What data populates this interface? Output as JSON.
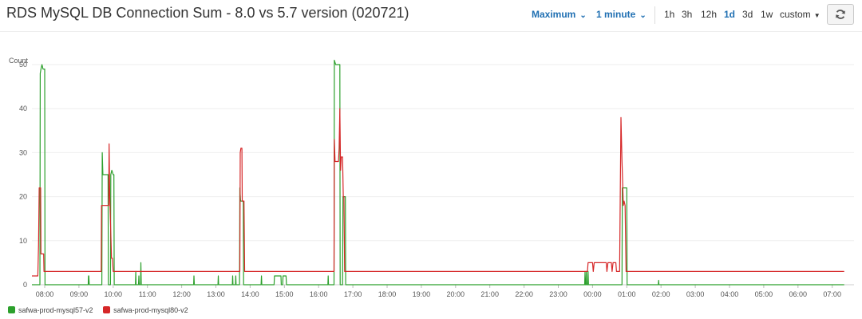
{
  "header": {
    "title": "RDS MySQL DB Connection Sum - 8.0 vs 5.7 version (020721)"
  },
  "toolbar": {
    "statistic": "Maximum",
    "period": "1 minute",
    "ranges": [
      "1h",
      "3h",
      "12h",
      "1d",
      "3d",
      "1w"
    ],
    "active_range": "1d",
    "custom_label": "custom",
    "refresh_icon": "refresh-icon"
  },
  "colors": {
    "series_57": "#2ca02c",
    "series_80": "#d62728",
    "accent": "#1f6fb2"
  },
  "chart_data": {
    "type": "line",
    "ylabel": "Count",
    "ylim": [
      0,
      52
    ],
    "yticks": [
      0,
      10,
      20,
      30,
      40,
      50
    ],
    "grid": true,
    "legend_position": "bottom-left",
    "x_ticks": [
      "08:00",
      "09:00",
      "10:00",
      "11:00",
      "12:00",
      "13:00",
      "14:00",
      "15:00",
      "16:00",
      "17:00",
      "18:00",
      "19:00",
      "20:00",
      "21:00",
      "22:00",
      "23:00",
      "00:00",
      "01:00",
      "02:00",
      "03:00",
      "04:00",
      "05:00",
      "06:00",
      "07:00"
    ],
    "x_range_hours": [
      7.55,
      31.35
    ],
    "series": [
      {
        "name": "safwa-prod-mysql57-v2",
        "color": "#2ca02c",
        "points": [
          [
            7.55,
            0
          ],
          [
            7.86,
            0
          ],
          [
            7.87,
            48
          ],
          [
            7.89,
            49
          ],
          [
            7.92,
            50
          ],
          [
            7.95,
            49
          ],
          [
            8.0,
            49
          ],
          [
            8.01,
            0
          ],
          [
            9.27,
            0
          ],
          [
            9.28,
            2
          ],
          [
            9.29,
            2
          ],
          [
            9.3,
            0
          ],
          [
            9.67,
            0
          ],
          [
            9.68,
            30
          ],
          [
            9.7,
            25
          ],
          [
            9.85,
            25
          ],
          [
            9.86,
            0
          ],
          [
            9.92,
            0
          ],
          [
            9.93,
            25
          ],
          [
            9.96,
            26
          ],
          [
            10.0,
            25
          ],
          [
            10.02,
            25
          ],
          [
            10.03,
            0
          ],
          [
            10.65,
            0
          ],
          [
            10.66,
            3
          ],
          [
            10.67,
            0
          ],
          [
            10.74,
            0
          ],
          [
            10.75,
            2
          ],
          [
            10.76,
            0
          ],
          [
            10.8,
            0
          ],
          [
            10.81,
            5
          ],
          [
            10.82,
            0
          ],
          [
            12.35,
            0
          ],
          [
            12.36,
            2
          ],
          [
            12.37,
            0
          ],
          [
            13.06,
            0
          ],
          [
            13.07,
            2
          ],
          [
            13.08,
            0
          ],
          [
            13.48,
            0
          ],
          [
            13.49,
            2
          ],
          [
            13.5,
            0
          ],
          [
            13.57,
            0
          ],
          [
            13.58,
            2
          ],
          [
            13.59,
            0
          ],
          [
            13.69,
            0
          ],
          [
            13.7,
            22
          ],
          [
            13.72,
            19
          ],
          [
            13.8,
            19
          ],
          [
            13.81,
            0
          ],
          [
            14.32,
            0
          ],
          [
            14.33,
            2
          ],
          [
            14.34,
            0
          ],
          [
            14.7,
            0
          ],
          [
            14.71,
            2
          ],
          [
            14.9,
            2
          ],
          [
            14.91,
            0
          ],
          [
            14.95,
            0
          ],
          [
            14.96,
            2
          ],
          [
            15.05,
            2
          ],
          [
            15.06,
            0
          ],
          [
            16.27,
            0
          ],
          [
            16.28,
            2
          ],
          [
            16.29,
            0
          ],
          [
            16.45,
            0
          ],
          [
            16.46,
            51
          ],
          [
            16.5,
            50
          ],
          [
            16.62,
            50
          ],
          [
            16.63,
            0
          ],
          [
            16.7,
            0
          ],
          [
            16.71,
            20
          ],
          [
            16.78,
            20
          ],
          [
            16.79,
            0
          ],
          [
            23.77,
            0
          ],
          [
            23.78,
            3
          ],
          [
            23.79,
            0
          ],
          [
            23.81,
            0
          ],
          [
            23.82,
            3
          ],
          [
            23.83,
            0
          ],
          [
            23.86,
            0
          ],
          [
            23.87,
            3
          ],
          [
            23.88,
            0
          ],
          [
            24.86,
            0
          ],
          [
            24.87,
            22
          ],
          [
            24.9,
            22
          ],
          [
            25.0,
            22
          ],
          [
            25.01,
            0
          ],
          [
            25.92,
            0
          ],
          [
            25.93,
            1
          ],
          [
            25.94,
            0
          ],
          [
            31.35,
            0
          ]
        ]
      },
      {
        "name": "safwa-prod-mysql80-v2",
        "color": "#d62728",
        "points": [
          [
            7.55,
            2
          ],
          [
            7.8,
            2
          ],
          [
            7.82,
            9
          ],
          [
            7.84,
            22
          ],
          [
            7.88,
            22
          ],
          [
            7.89,
            7
          ],
          [
            7.97,
            7
          ],
          [
            7.98,
            3
          ],
          [
            9.65,
            3
          ],
          [
            9.66,
            18
          ],
          [
            9.7,
            18
          ],
          [
            9.87,
            18
          ],
          [
            9.88,
            32
          ],
          [
            9.9,
            20
          ],
          [
            9.95,
            6
          ],
          [
            9.98,
            6
          ],
          [
            10.0,
            3
          ],
          [
            13.7,
            3
          ],
          [
            13.71,
            30
          ],
          [
            13.73,
            31
          ],
          [
            13.76,
            31
          ],
          [
            13.77,
            19
          ],
          [
            13.82,
            19
          ],
          [
            13.84,
            3
          ],
          [
            16.45,
            3
          ],
          [
            16.46,
            33
          ],
          [
            16.48,
            28
          ],
          [
            16.58,
            28
          ],
          [
            16.6,
            31
          ],
          [
            16.62,
            40
          ],
          [
            16.64,
            26
          ],
          [
            16.66,
            29
          ],
          [
            16.7,
            29
          ],
          [
            16.72,
            20
          ],
          [
            16.74,
            20
          ],
          [
            16.76,
            3
          ],
          [
            23.85,
            3
          ],
          [
            23.87,
            5
          ],
          [
            24.0,
            5
          ],
          [
            24.02,
            3
          ],
          [
            24.05,
            5
          ],
          [
            24.4,
            5
          ],
          [
            24.42,
            3
          ],
          [
            24.45,
            5
          ],
          [
            24.55,
            5
          ],
          [
            24.57,
            3
          ],
          [
            24.6,
            5
          ],
          [
            24.68,
            5
          ],
          [
            24.7,
            3
          ],
          [
            24.79,
            3
          ],
          [
            24.81,
            20
          ],
          [
            24.83,
            38
          ],
          [
            24.86,
            28
          ],
          [
            24.9,
            18
          ],
          [
            24.92,
            19
          ],
          [
            24.95,
            18
          ],
          [
            24.98,
            3
          ],
          [
            31.35,
            3
          ]
        ]
      }
    ]
  }
}
